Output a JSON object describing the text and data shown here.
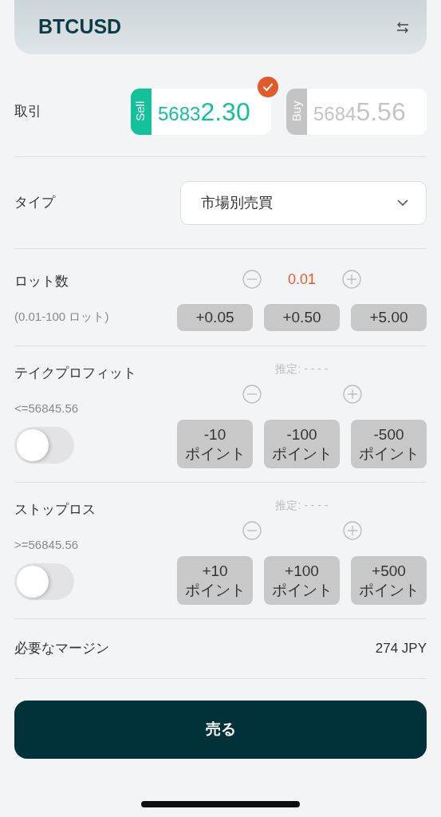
{
  "symbol": {
    "name": "BTCUSD"
  },
  "trade": {
    "label": "取引",
    "options": [
      {
        "kind": "sell",
        "tag": "Sell",
        "price_head": "5683",
        "price_tail": "2.30",
        "selected": true
      },
      {
        "kind": "buy",
        "tag": "Buy",
        "price_head": "5684",
        "price_tail": "5.56",
        "selected": false
      }
    ]
  },
  "order_type": {
    "label": "タイプ",
    "value": "市場別売買"
  },
  "lots": {
    "label": "ロット数",
    "range": "(0.01-100 ロット)",
    "value": "0.01",
    "presets": [
      "+0.05",
      "+0.50",
      "+5.00"
    ]
  },
  "protections": [
    {
      "label": "テイクプロフィット",
      "limit": "<=56845.56",
      "estimate": "推定: - - - -",
      "on": false,
      "presets": [
        {
          "value": "-10",
          "unit": "ポイント"
        },
        {
          "value": "-100",
          "unit": "ポイント"
        },
        {
          "value": "-500",
          "unit": "ポイント"
        }
      ]
    },
    {
      "label": "ストップロス",
      "limit": ">=56845.56",
      "estimate": "推定: - - - -",
      "on": false,
      "presets": [
        {
          "value": "+10",
          "unit": "ポイント"
        },
        {
          "value": "+100",
          "unit": "ポイント"
        },
        {
          "value": "+500",
          "unit": "ポイント"
        }
      ]
    }
  ],
  "margin": {
    "label": "必要なマージン",
    "value": "274 JPY"
  },
  "submit": {
    "label": "売る"
  }
}
